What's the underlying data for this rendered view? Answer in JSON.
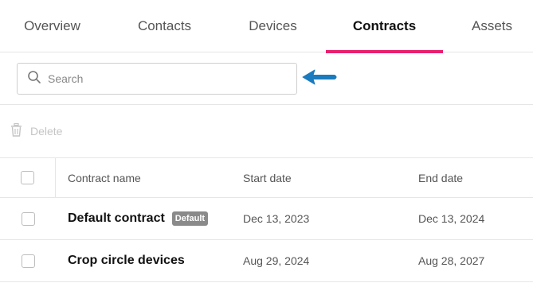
{
  "colors": {
    "accent": "#e8206e",
    "arrow": "#1a7bbf"
  },
  "tabs": [
    {
      "label": "Overview"
    },
    {
      "label": "Contacts"
    },
    {
      "label": "Devices"
    },
    {
      "label": "Contracts",
      "active": true
    },
    {
      "label": "Assets"
    }
  ],
  "search": {
    "placeholder": "Search",
    "value": ""
  },
  "toolbar": {
    "delete_label": "Delete"
  },
  "table": {
    "headers": {
      "name": "Contract name",
      "start": "Start date",
      "end": "End date"
    },
    "rows": [
      {
        "name": "Default contract",
        "badge": "Default",
        "start": "Dec 13, 2023",
        "end": "Dec 13, 2024"
      },
      {
        "name": "Crop circle devices",
        "start": "Aug 29, 2024",
        "end": "Aug 28, 2027"
      }
    ]
  }
}
